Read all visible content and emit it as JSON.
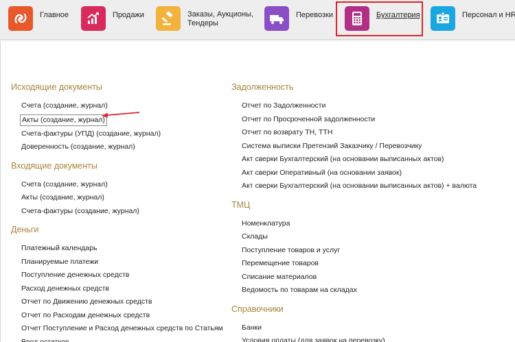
{
  "nav": {
    "items": [
      {
        "label": "Главное",
        "icon": "logo-icon",
        "color": "#e8582a"
      },
      {
        "label": "Продажи",
        "icon": "growth-chart-icon",
        "color": "#d92a5c"
      },
      {
        "label": "Заказы,  Аукционы, Тендеры",
        "icon": "gavel-icon",
        "color": "#f2b23c"
      },
      {
        "label": "Перевозки",
        "icon": "truck-icon",
        "color": "#8a4fc7"
      },
      {
        "label": "Бухгалтерия",
        "icon": "calculator-icon",
        "color": "#b22f86"
      },
      {
        "label": "Персонал и HR",
        "icon": "id-card-icon",
        "color": "#1aa6e0"
      }
    ],
    "active": "Бухгалтерия",
    "active_border_color": "#d9262b"
  },
  "left": {
    "outgoing": {
      "title": "Исходящие документы",
      "items": [
        "Счета (создание, журнал)",
        "Акты (создание, журнал)",
        "Счета-фактуры (УПД) (создание, журнал)",
        "Доверенность (создание, журнал)"
      ]
    },
    "incoming": {
      "title": "Входящие документы",
      "items": [
        "Счета (создание, журнал)",
        "Акты (создание, журнал)",
        "Счета-фактуры (создание, журнал)"
      ]
    },
    "money": {
      "title": "Деньги",
      "items": [
        "Платежный календарь",
        "Планируемые платежи",
        "Поступление денежных средств",
        "Расход денежных средств",
        "Отчет по Движению денежных средств",
        "Отчет по Расходам денежных средств",
        "Отчет Поступление и Расход денежных средств по Статьям",
        "Ввод остатков"
      ]
    }
  },
  "right": {
    "debt": {
      "title": "Задолженность",
      "items": [
        "Отчет по Задолженности",
        "Отчет по Просроченной задолженности",
        "Отчет по возврату ТН, ТТН",
        "Система выписки Претензий Заказчику / Перевозчику",
        "Акт сверки Бухгалтерский (на основании выписанных актов)",
        "Акт сверки Оперативный (на основании заявок)",
        "Акт сверки Бухгалтерский (на основании выписанных актов) + валюта"
      ]
    },
    "tmc": {
      "title": "ТМЦ",
      "items": [
        "Номенклатура",
        "Склады",
        "Поступление товаров и услуг",
        "Перемещение товаров",
        "Списание материалов",
        "Ведомость по товарам на складах"
      ]
    },
    "refs": {
      "title": "Справочники",
      "items": [
        "Банки",
        "Условия оплаты (для заявок на перевозку)"
      ]
    }
  },
  "colors": {
    "section_title": "#a8853c",
    "arrow": "#d9262b"
  }
}
